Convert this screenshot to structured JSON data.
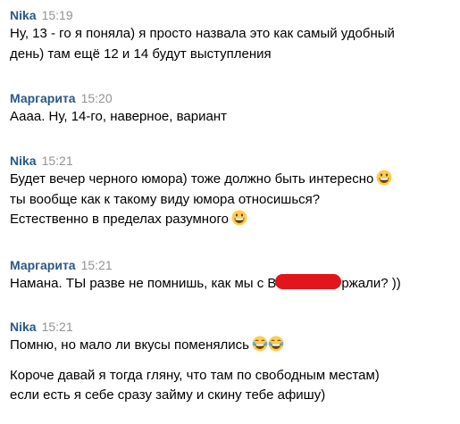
{
  "messages": [
    {
      "author": "Nika",
      "time": "15:19",
      "lines": [
        "Ну, 13 - го я поняла) я просто назвала это как самый удобный",
        "день) там ещё 12 и 14 будут выступления"
      ]
    },
    {
      "author": "Маргарита",
      "time": "15:20",
      "lines": [
        "Аааа. Ну, 14-го, наверное, вариант"
      ]
    },
    {
      "author": "Nika",
      "time": "15:21",
      "lines": [
        "Будет вечер черного юмора) тоже должно быть интересно",
        "ты вообще как к такому виду юмора относишься?",
        "Естественно в пределах разумного"
      ],
      "emoji": "grinning-face-emoji"
    },
    {
      "author": "Маргарита",
      "time": "15:21",
      "line_before": "Намана. ТЫ разве не помнишь, как мы с В",
      "line_after": "ржали? ))"
    },
    {
      "author": "Nika",
      "time": "15:21",
      "lines": [
        "Помню, но мало ли вкусы поменялись",
        "Короче давай я тогда гляну, что там по свободным местам)",
        "если есть я себе сразу займу и скину тебе афишу)"
      ],
      "emoji": "tears-of-joy-emoji"
    }
  ],
  "colors": {
    "author": "#2a5885",
    "time": "#939393",
    "text": "#000000",
    "redaction": "#e2141c",
    "emoji_face": "#ffcc4d"
  }
}
